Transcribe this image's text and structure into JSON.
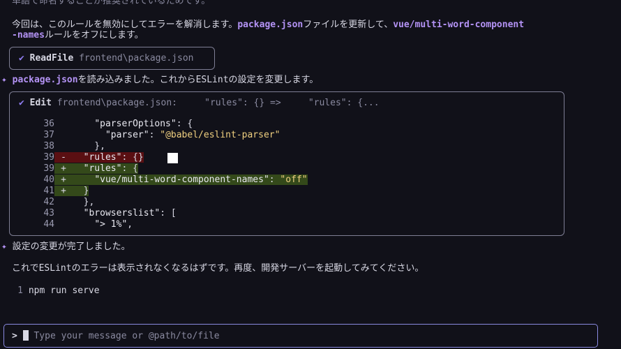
{
  "top_text": {
    "line0": "単語で命名することが推奨されているためです。",
    "line1_prefix": "今回は、このルールを無効にしてエラーを解消します。",
    "line1_code": "package.json",
    "line1_mid": "ファイルを更新して、",
    "line1_code2": "vue/multi-word-component",
    "line2_code": "-names",
    "line2_suffix": "ルールをオフにします。"
  },
  "readfile_tool": {
    "name": "ReadFile",
    "path": "frontend\\package.json"
  },
  "read_done_msg": {
    "code": "package.json",
    "text": "を読み込みました。これからESLintの設定を変更します。"
  },
  "edit_tool": {
    "name": "Edit",
    "summary": "frontend\\package.json:     \"rules\": {} =>     \"rules\": {..."
  },
  "diff_lines": [
    {
      "num": "36",
      "mark": " ",
      "type": "ctx",
      "text": "    \"parserOptions\": {"
    },
    {
      "num": "37",
      "mark": " ",
      "type": "ctx",
      "text": "      \"parser\": \"@babel/eslint-parser\""
    },
    {
      "num": "38",
      "mark": " ",
      "type": "ctx",
      "text": "    },"
    },
    {
      "num": "39",
      "mark": "-",
      "type": "del",
      "text": "  \"rules\": {}"
    },
    {
      "num": "39",
      "mark": "+",
      "type": "add",
      "text": "  \"rules\": {"
    },
    {
      "num": "40",
      "mark": "+",
      "type": "add",
      "text": "    \"vue/multi-word-component-names\": \"off\""
    },
    {
      "num": "41",
      "mark": "+",
      "type": "add",
      "text": "  }"
    },
    {
      "num": "42",
      "mark": " ",
      "type": "ctx",
      "text": "  },"
    },
    {
      "num": "43",
      "mark": " ",
      "type": "ctx",
      "text": "  \"browserslist\": ["
    },
    {
      "num": "44",
      "mark": " ",
      "type": "ctx",
      "text": "    \"> 1%\","
    }
  ],
  "done_msg": "設定の変更が完了しました。",
  "followup_msg": "これでESLintのエラーは表示されなくなるはずです。再度、開発サーバーを起動してみてください。",
  "command_block": {
    "line_num": "1",
    "command": "npm run serve"
  },
  "input": {
    "prompt": ">",
    "placeholder": "Type your message or @path/to/file"
  },
  "colors": {
    "background": "#111119",
    "accent": "#b493f5",
    "deleted_bg": "#5a0f12",
    "added_bg": "#34491a",
    "input_border": "#8a8ae0"
  },
  "icons": {
    "check": "check-icon",
    "sparkle": "sparkle-icon"
  }
}
